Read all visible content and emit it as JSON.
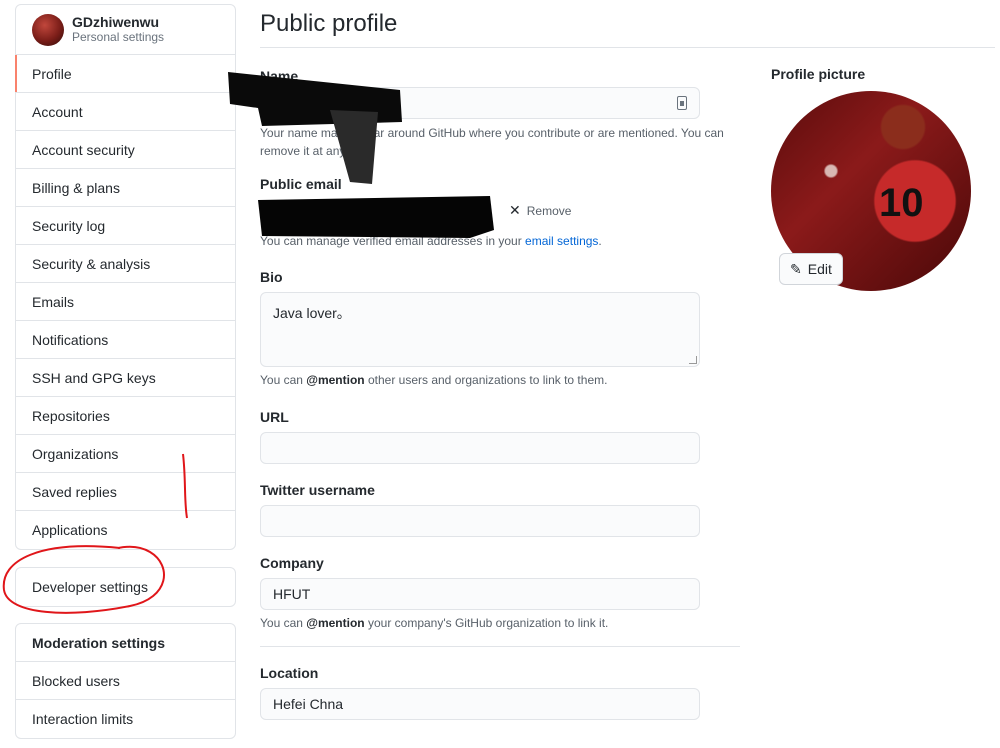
{
  "user": {
    "name": "GDzhiwenwu",
    "subtitle": "Personal settings"
  },
  "sidebar": {
    "items": [
      {
        "label": "Profile",
        "selected": true
      },
      {
        "label": "Account"
      },
      {
        "label": "Account security"
      },
      {
        "label": "Billing & plans"
      },
      {
        "label": "Security log"
      },
      {
        "label": "Security & analysis"
      },
      {
        "label": "Emails"
      },
      {
        "label": "Notifications"
      },
      {
        "label": "SSH and GPG keys"
      },
      {
        "label": "Repositories"
      },
      {
        "label": "Organizations"
      },
      {
        "label": "Saved replies"
      },
      {
        "label": "Applications"
      }
    ],
    "developer": "Developer settings",
    "moderation": {
      "title": "Moderation settings",
      "items": [
        {
          "label": "Blocked users"
        },
        {
          "label": "Interaction limits"
        }
      ]
    }
  },
  "main": {
    "title": "Public profile",
    "name": {
      "label": "Name",
      "value": "",
      "note": "Your name may appear around GitHub where you contribute or are mentioned. You can remove it at any time."
    },
    "email": {
      "label": "Public email",
      "remove": "Remove",
      "note_prefix": "You can manage verified email addresses in your ",
      "note_link": "email settings",
      "note_suffix": "."
    },
    "bio": {
      "label": "Bio",
      "value": "Java lover。",
      "note_prefix": "You can ",
      "note_mention": "@mention",
      "note_suffix": " other users and organizations to link to them."
    },
    "url": {
      "label": "URL",
      "value": ""
    },
    "twitter": {
      "label": "Twitter username",
      "value": ""
    },
    "company": {
      "label": "Company",
      "value": "HFUT",
      "note_prefix": "You can ",
      "note_mention": "@mention",
      "note_suffix": " your company's GitHub organization to link it."
    },
    "location": {
      "label": "Location",
      "value": "Hefei Chna"
    }
  },
  "picture": {
    "label": "Profile picture",
    "edit": "Edit",
    "jersey": "10"
  },
  "icons": {
    "edit": "pencil-icon",
    "remove": "x-icon",
    "name_field": "contact-card-icon"
  },
  "colors": {
    "selected_accent": "#f9826c",
    "link": "#0366d6",
    "annotation": "#e0161a"
  }
}
